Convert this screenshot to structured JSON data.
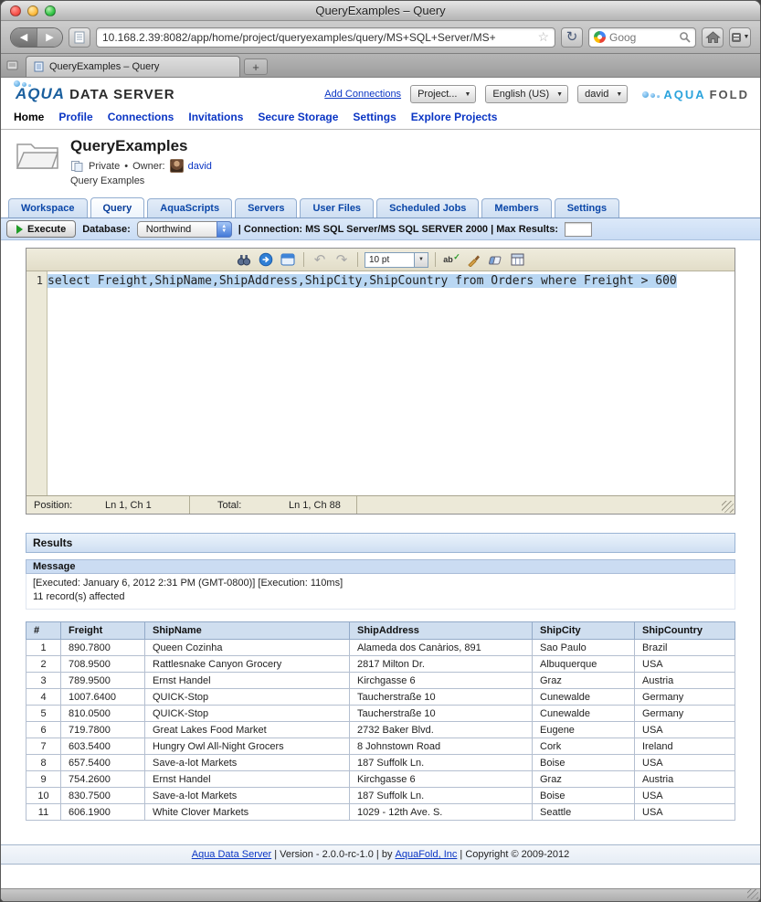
{
  "window": {
    "title": "QueryExamples – Query",
    "url": "10.168.2.39:8082/app/home/project/queryexamples/query/MS+SQL+Server/MS+",
    "search_text": "Goog",
    "tab_title": "QueryExamples – Query",
    "new_tab_label": "+"
  },
  "header": {
    "logo_aqua": "AQUA",
    "logo_rest": "DATA SERVER",
    "add_connections": "Add Connections",
    "project_select": "Project...",
    "language_select": "English (US)",
    "user_select": "david",
    "brand_aqua": "AQUA",
    "brand_fold": "FOLD"
  },
  "nav": {
    "items": [
      {
        "label": "Home",
        "active": true
      },
      {
        "label": "Profile"
      },
      {
        "label": "Connections"
      },
      {
        "label": "Invitations"
      },
      {
        "label": "Secure Storage"
      },
      {
        "label": "Settings"
      },
      {
        "label": "Explore Projects"
      }
    ]
  },
  "project": {
    "name": "QueryExamples",
    "visibility": "Private",
    "bullet": "•",
    "owner_label": "Owner:",
    "owner_name": "david",
    "description": "Query Examples"
  },
  "tabs": {
    "items": [
      {
        "label": "Workspace"
      },
      {
        "label": "Query",
        "active": true
      },
      {
        "label": "AquaScripts"
      },
      {
        "label": "Servers"
      },
      {
        "label": "User Files"
      },
      {
        "label": "Scheduled Jobs"
      },
      {
        "label": "Members"
      },
      {
        "label": "Settings"
      }
    ]
  },
  "toolbar": {
    "execute_label": "Execute",
    "database_label": "Database:",
    "database_value": "Northwind",
    "connection_text": "| Connection: MS SQL Server/MS SQL SERVER 2000 | Max Results:"
  },
  "editor": {
    "font_size": "10 pt",
    "line_number": "1",
    "sql": "select Freight,ShipName,ShipAddress,ShipCity,ShipCountry from Orders where Freight > 600",
    "status": {
      "position_label": "Position:",
      "position_value": "Ln 1, Ch 1",
      "total_label": "Total:",
      "total_value": "Ln 1, Ch 88"
    }
  },
  "results": {
    "title": "Results",
    "message_title": "Message",
    "message_lines": [
      "[Executed: January 6, 2012 2:31 PM (GMT-0800)] [Execution: 110ms]",
      "11 record(s) affected"
    ],
    "table": {
      "columns": [
        "#",
        "Freight",
        "ShipName",
        "ShipAddress",
        "ShipCity",
        "ShipCountry"
      ],
      "rows": [
        [
          "1",
          "890.7800",
          "Queen Cozinha",
          "Alameda dos Canàrios, 891",
          "Sao Paulo",
          "Brazil"
        ],
        [
          "2",
          "708.9500",
          "Rattlesnake Canyon Grocery",
          "2817 Milton Dr.",
          "Albuquerque",
          "USA"
        ],
        [
          "3",
          "789.9500",
          "Ernst Handel",
          "Kirchgasse 6",
          "Graz",
          "Austria"
        ],
        [
          "4",
          "1007.6400",
          "QUICK-Stop",
          "Taucherstraße 10",
          "Cunewalde",
          "Germany"
        ],
        [
          "5",
          "810.0500",
          "QUICK-Stop",
          "Taucherstraße 10",
          "Cunewalde",
          "Germany"
        ],
        [
          "6",
          "719.7800",
          "Great Lakes Food Market",
          "2732 Baker Blvd.",
          "Eugene",
          "USA"
        ],
        [
          "7",
          "603.5400",
          "Hungry Owl All-Night Grocers",
          "8 Johnstown Road",
          "Cork",
          "Ireland"
        ],
        [
          "8",
          "657.5400",
          "Save-a-lot Markets",
          "187 Suffolk Ln.",
          "Boise",
          "USA"
        ],
        [
          "9",
          "754.2600",
          "Ernst Handel",
          "Kirchgasse 6",
          "Graz",
          "Austria"
        ],
        [
          "10",
          "830.7500",
          "Save-a-lot Markets",
          "187 Suffolk Ln.",
          "Boise",
          "USA"
        ],
        [
          "11",
          "606.1900",
          "White Clover Markets",
          "1029 - 12th Ave. S.",
          "Seattle",
          "USA"
        ]
      ]
    }
  },
  "footer": {
    "link1": "Aqua Data Server",
    "mid1": " | Version - 2.0.0-rc-1.0 | by ",
    "link2": "AquaFold, Inc",
    "mid2": " | Copyright © 2009-2012"
  }
}
